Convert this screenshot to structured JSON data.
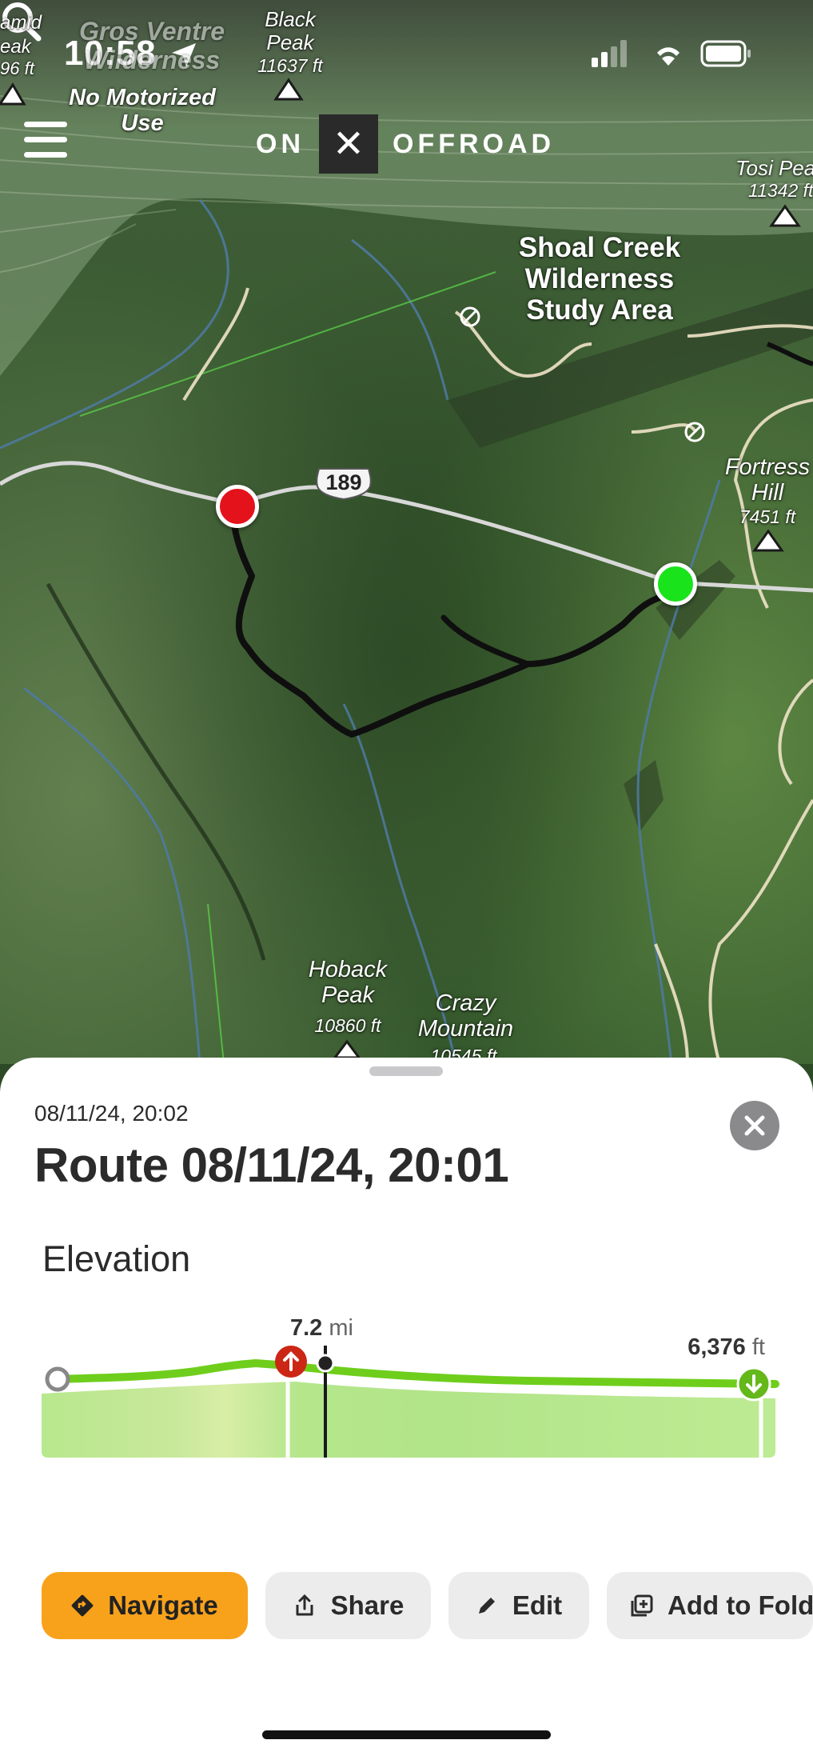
{
  "status_bar": {
    "time": "10:58",
    "icons": [
      "location-arrow-icon",
      "signal-icon",
      "wifi-icon",
      "battery-icon"
    ]
  },
  "header": {
    "menu_icon": "hamburger-menu-icon",
    "logo_left": "ON",
    "logo_mark": "✕",
    "logo_right": "OFFROAD",
    "search_icon": "search-icon"
  },
  "map": {
    "labels": {
      "gros_ventre": "Gros Ventre Wilderness",
      "no_motorized": "No Motorized Use",
      "pyramid": "amid",
      "pyramid_peak": "eak",
      "pyramid_elev": "96 ft",
      "black_peak": "Black Peak",
      "black_peak_elev": "11637 ft",
      "tosi_peak": "Tosi Pea",
      "tosi_peak_elev": "11342 ft",
      "shoal_creek": "Shoal Creek Wilderness Study Area",
      "fortress_hill": "Fortress Hill",
      "fortress_hill_elev": "7451 ft",
      "hoback_peak": "Hoback Peak",
      "hoback_peak_elev": "10860 ft",
      "crazy_mountain": "Crazy Mountain",
      "crazy_mountain_elev": "10545 ft",
      "highway": "189"
    },
    "colors": {
      "start_marker": "#e3121b",
      "end_marker": "#18e31b",
      "route": "#0f0f0f"
    }
  },
  "sheet": {
    "date": "08/11/24, 20:02",
    "title": "Route 08/11/24, 20:01",
    "section": "Elevation",
    "close_icon": "close-icon",
    "elevation": {
      "distance_value": "7.2",
      "distance_unit": "mi",
      "elevation_value": "6,376",
      "elevation_unit": "ft"
    }
  },
  "actions": {
    "navigate": "Navigate",
    "share": "Share",
    "edit": "Edit",
    "add_to_folder": "Add to Fold"
  },
  "colors": {
    "accent": "#f8a21c",
    "elevation_fill": "#b9ea8e",
    "elevation_line": "#6fce1c"
  }
}
